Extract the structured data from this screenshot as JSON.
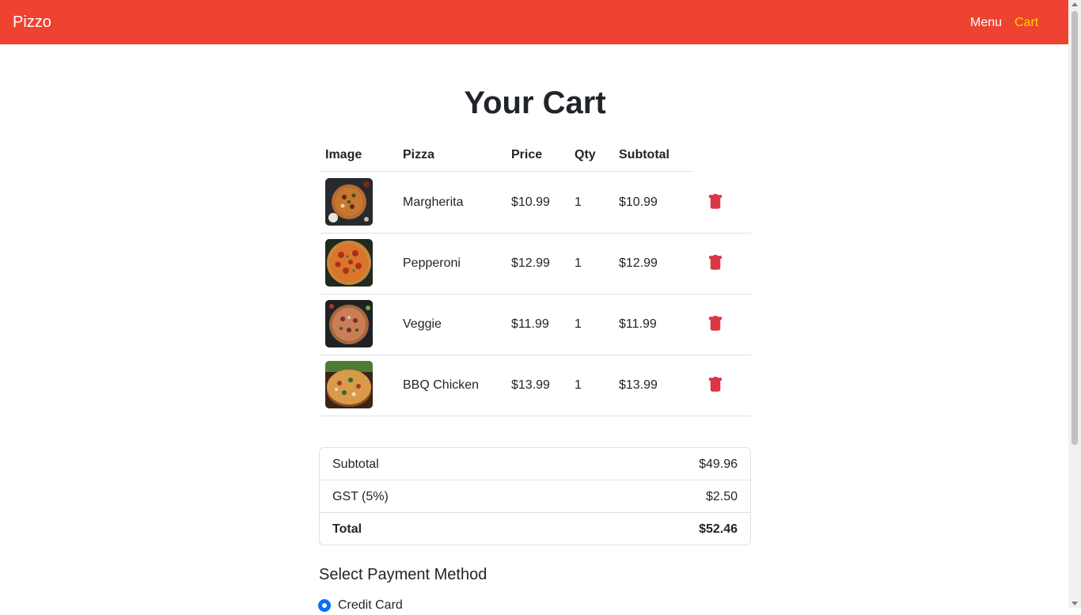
{
  "navbar": {
    "brand": "Pizzo",
    "links": [
      {
        "label": "Menu",
        "active": false
      },
      {
        "label": "Cart",
        "active": true
      }
    ],
    "bg_color": "#ee4331",
    "active_color": "#ffd400"
  },
  "page": {
    "title": "Your Cart"
  },
  "cart": {
    "headers": [
      "Image",
      "Pizza",
      "Price",
      "Qty",
      "Subtotal"
    ],
    "items": [
      {
        "name": "Margherita",
        "price": "$10.99",
        "qty": "1",
        "subtotal": "$10.99",
        "image": "margherita-pizza-image"
      },
      {
        "name": "Pepperoni",
        "price": "$12.99",
        "qty": "1",
        "subtotal": "$12.99",
        "image": "pepperoni-pizza-image"
      },
      {
        "name": "Veggie",
        "price": "$11.99",
        "qty": "1",
        "subtotal": "$11.99",
        "image": "veggie-pizza-image"
      },
      {
        "name": "BBQ Chicken",
        "price": "$13.99",
        "qty": "1",
        "subtotal": "$13.99",
        "image": "bbq-chicken-pizza-image"
      }
    ],
    "delete_icon": "trash-icon",
    "delete_color": "#dc3545"
  },
  "summary": {
    "subtotal_label": "Subtotal",
    "subtotal_value": "$49.96",
    "gst_label": "GST (5%)",
    "gst_value": "$2.50",
    "total_label": "Total",
    "total_value": "$52.46"
  },
  "payment": {
    "title": "Select Payment Method",
    "options": [
      {
        "label": "Credit Card",
        "selected": true
      }
    ],
    "accent_color": "#0d6efd"
  }
}
